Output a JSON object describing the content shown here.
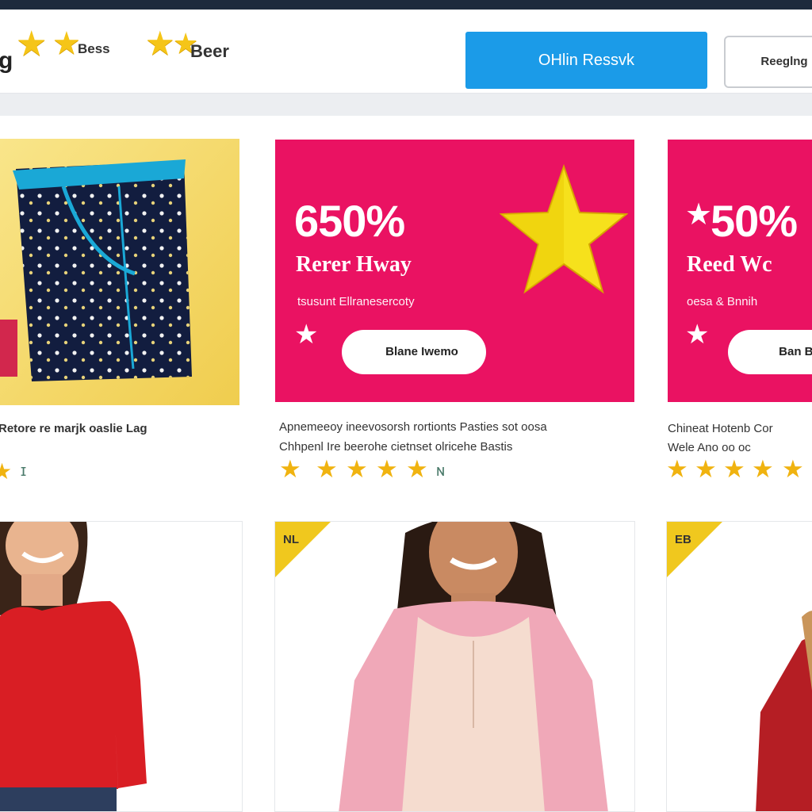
{
  "header": {
    "logo_fragment": "g",
    "ratings": [
      {
        "stars": 2,
        "label": "Bess"
      },
      {
        "stars": 2,
        "label": "Beer"
      }
    ],
    "primary_button": "OHlin Ressvk",
    "secondary_button": "Reeglng"
  },
  "cards": [
    {
      "type": "product-image",
      "description": "Retore re marjk oaslie Lag"
    },
    {
      "type": "promo",
      "headline": "650%",
      "subline": "Rerer Hway",
      "detail": "tsusunt Ellranesercoty",
      "cta": "Blane Iwemo",
      "description_line1": "Apnemeeoy  ineevosorsh rortionts Pasties sot oosa",
      "description_line2": "Chhpenl  Ire beerohe cietnset olricehe Bastis",
      "rating": 5
    },
    {
      "type": "promo",
      "headline": "50%",
      "subline": "Reed Wc",
      "detail": "oesa & Bnnih",
      "cta": "Ban Be",
      "description_line1": "Chineat  Hotenb Cor",
      "description_line2": "Wele  Ano oo oc",
      "rating": 5
    }
  ],
  "products": [
    {
      "badge": ""
    },
    {
      "badge": "NL"
    },
    {
      "badge": "EB"
    }
  ],
  "colors": {
    "promo": "#ea1262",
    "primary": "#1b9be8",
    "star": "#f5c518",
    "product_badge": "#f0c81e"
  }
}
